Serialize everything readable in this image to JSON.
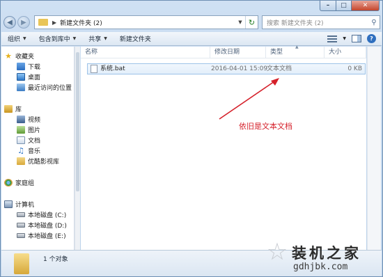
{
  "window": {
    "caption_buttons": {
      "minimize": "–",
      "maximize": "□",
      "close": "✕"
    }
  },
  "address": {
    "path": "新建文件夹 (2)",
    "search_placeholder": "搜索 新建文件夹 (2)"
  },
  "toolbar": {
    "organize": "组织",
    "include_in_library": "包含到库中",
    "share": "共享",
    "new_folder": "新建文件夹"
  },
  "nav": {
    "favorites": {
      "label": "收藏夹",
      "items": [
        "下载",
        "桌面",
        "最近访问的位置"
      ]
    },
    "libraries": {
      "label": "库",
      "items": [
        "视频",
        "图片",
        "文档",
        "音乐",
        "优酷影视库"
      ]
    },
    "homegroup": "家庭组",
    "computer": {
      "label": "计算机",
      "items": [
        "本地磁盘 (C:)",
        "本地磁盘 (D:)",
        "本地磁盘 (E:)"
      ]
    }
  },
  "columns": {
    "name": "名称",
    "date": "修改日期",
    "type": "类型",
    "size": "大小"
  },
  "files": [
    {
      "name": "系统.bat",
      "date": "2016-04-01 15:09",
      "type": "文本文档",
      "size": "0 KB"
    }
  ],
  "annotation": {
    "text": "依旧是文本文档",
    "color": "#d5202a"
  },
  "status": {
    "count": "1 个对象"
  },
  "watermark": {
    "title": "装机之家",
    "url": "gdhjbk.com"
  }
}
